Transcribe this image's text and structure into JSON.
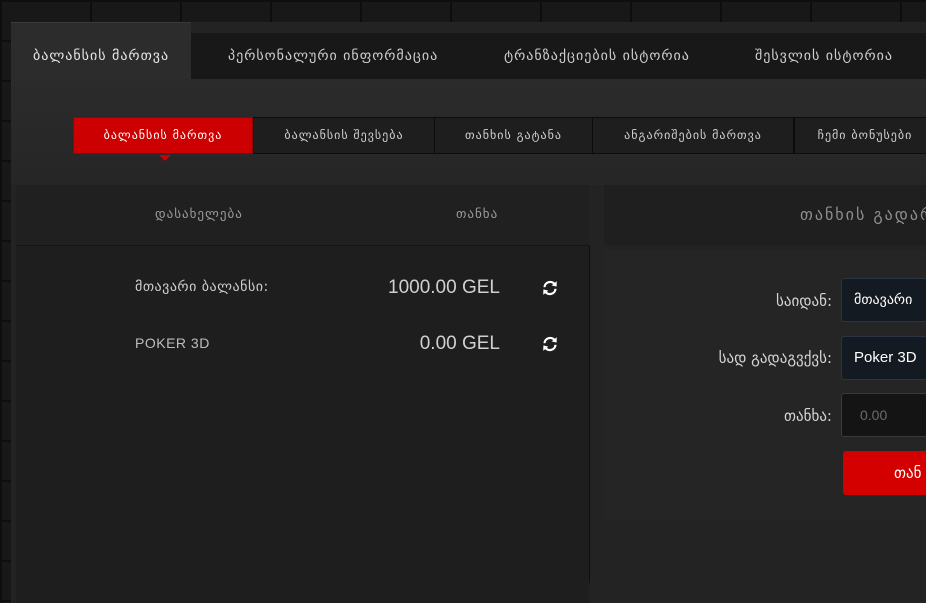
{
  "top_tabs": [
    {
      "label": "ბალანსის მართვა"
    },
    {
      "label": "პერსონალური ინფორმაცია"
    },
    {
      "label": "ტრანზაქციების ისტორია"
    },
    {
      "label": "შესვლის ისტორია"
    }
  ],
  "sub_tabs": [
    {
      "label": "ბალანსის მართვა"
    },
    {
      "label": "ბალანსის შევსება"
    },
    {
      "label": "თანხის გატანა"
    },
    {
      "label": "ანგარიშების მართვა"
    },
    {
      "label": "ჩემი ბონუსები"
    }
  ],
  "balances": {
    "header_name": "დასახელება",
    "header_amount": "თანხა",
    "rows": [
      {
        "name": "მთავარი ბალანსი:",
        "amount": "1000.00 GEL"
      },
      {
        "name": "POKER 3D",
        "amount": "0.00 GEL"
      }
    ]
  },
  "transfer": {
    "title": "თანხის გადარ",
    "from_label": "საიდან:",
    "from_value": "მთავარი",
    "to_label": "სად გადაგვქვს:",
    "to_value": "Poker 3D",
    "amount_label": "თანხა:",
    "amount_placeholder": "0.00",
    "submit_label": "თან"
  },
  "colors": {
    "accent": "#cc0000"
  }
}
